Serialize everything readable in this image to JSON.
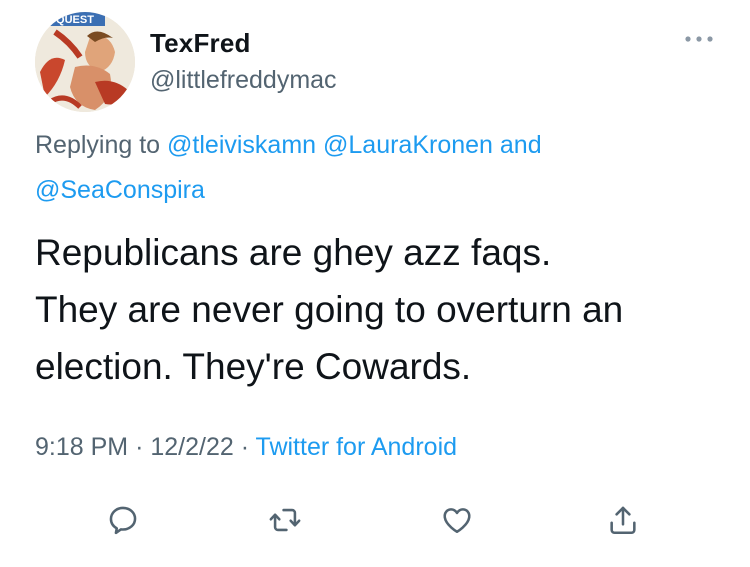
{
  "user": {
    "display_name": "TexFred",
    "handle": "@littlefreddymac",
    "avatar_caption": "QUEST"
  },
  "reply": {
    "prefix": "Replying to",
    "mentions": [
      "@tleiviskamn",
      "@LauraKronen"
    ],
    "conjunction": "and",
    "last_mention": "@SeaConspira"
  },
  "tweet": {
    "lines": [
      "Republicans are ghey azz faqs.",
      "They are never going to overturn an",
      "election. They're Cowards."
    ]
  },
  "meta": {
    "time": "9:18 PM",
    "separator": "·",
    "date": "12/2/22",
    "source": "Twitter for Android"
  },
  "actions": {
    "reply_icon": "reply-icon",
    "retweet_icon": "retweet-icon",
    "like_icon": "like-icon",
    "share_icon": "share-icon"
  },
  "colors": {
    "link": "#1d9bf0",
    "secondary": "#536471",
    "text": "#0f1419"
  }
}
